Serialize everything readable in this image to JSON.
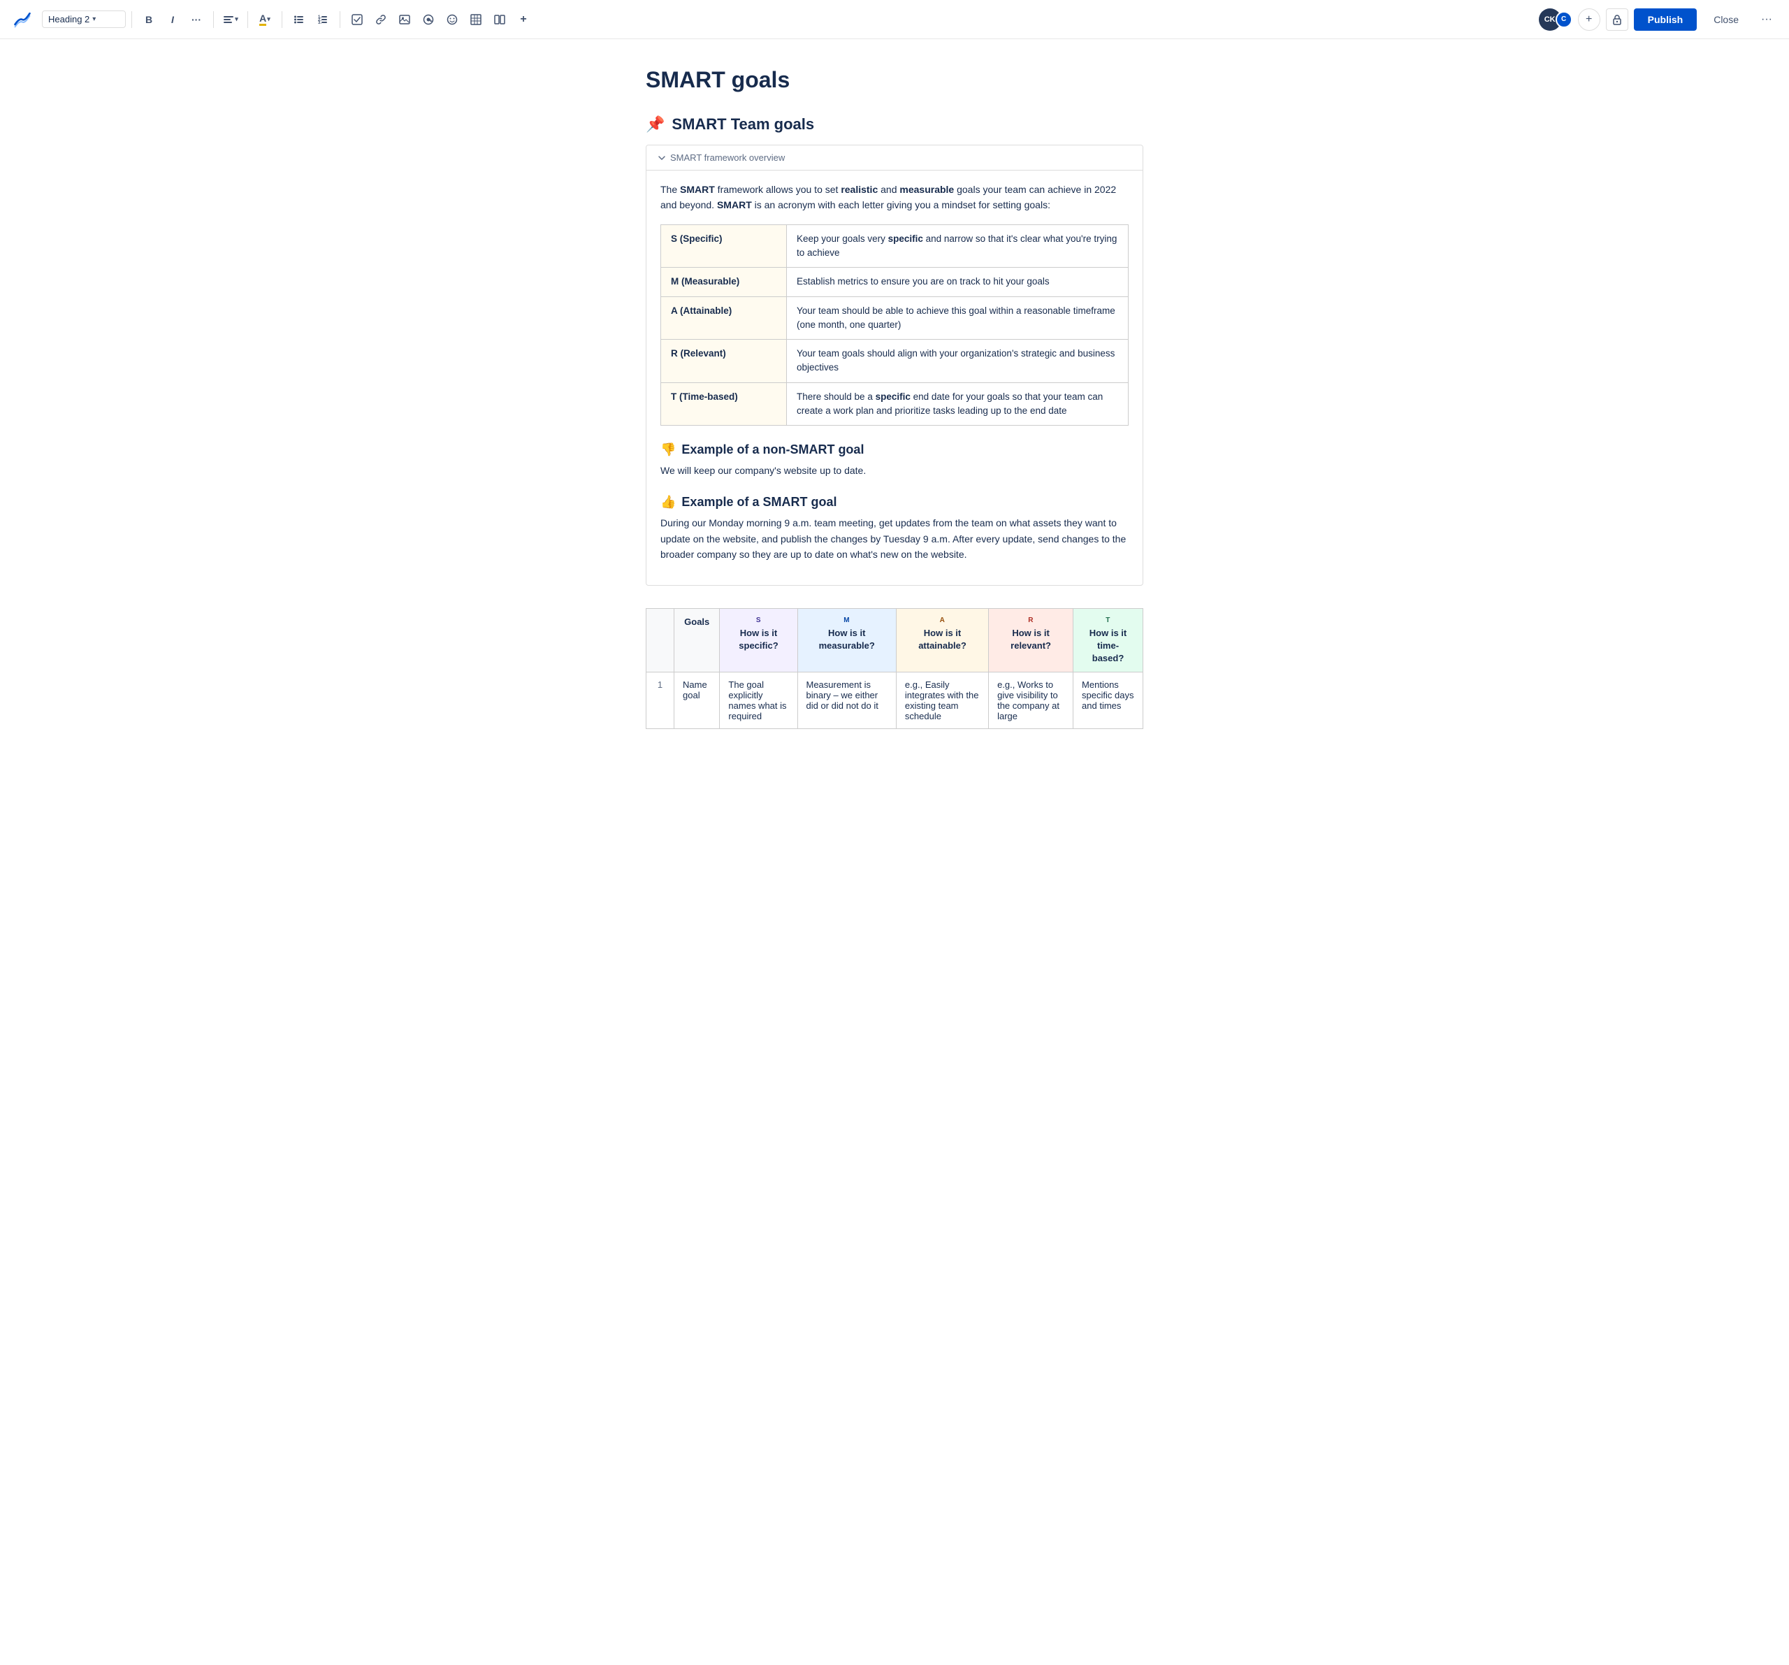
{
  "toolbar": {
    "logo_alt": "Confluence logo",
    "heading_selector": "Heading 2",
    "chevron": "▾",
    "bold": "B",
    "italic": "I",
    "more_format": "···",
    "align_icon": "≡",
    "color_icon": "A",
    "bullet_list": "☰",
    "number_list": "≡",
    "task": "☑",
    "link": "🔗",
    "media": "🖼",
    "mention": "@",
    "emoji": "☺",
    "table": "⊞",
    "column": "⊟",
    "insert": "+",
    "avatar_ck": "CK",
    "avatar_c": "C",
    "add_btn": "+",
    "lock_icon": "🔒",
    "publish_label": "Publish",
    "close_label": "Close",
    "more_options": "···"
  },
  "page": {
    "title": "SMART goals",
    "section_heading_emoji": "📌",
    "section_heading_text": "SMART Team goals",
    "expand_label": "SMART framework overview",
    "intro_text_1_pre": "The ",
    "intro_bold_1": "SMART",
    "intro_text_1_mid": " framework allows you to set ",
    "intro_bold_2": "realistic",
    "intro_text_1_and": " and ",
    "intro_bold_3": "measurable",
    "intro_text_1_post": " goals your team can achieve in 2022 and beyond. ",
    "intro_bold_4": "SMART",
    "intro_text_1_end": " is an acronym with each letter giving you a mindset for setting goals:",
    "smart_rows": [
      {
        "letter": "S (Specific)",
        "description": "Keep your goals very specific and narrow so that it's clear what you're trying to achieve"
      },
      {
        "letter": "M (Measurable)",
        "description": "Establish metrics to ensure you are on track to hit your goals"
      },
      {
        "letter": "A (Attainable)",
        "description": "Your team should be able to achieve this goal within a reasonable timeframe (one month, one quarter)"
      },
      {
        "letter": "R (Relevant)",
        "description": "Your team goals should align with your organization's strategic and business objectives"
      },
      {
        "letter": "T (Time-based)",
        "description": "There should be a specific end date for your goals so that your team can create a work plan and prioritize tasks leading up to the end date"
      }
    ],
    "non_smart_heading_emoji": "👎",
    "non_smart_heading_text": "Example of a non-SMART goal",
    "non_smart_body": "We will keep our company's website up to date.",
    "smart_heading_emoji": "👍",
    "smart_heading_text": "Example of a SMART goal",
    "smart_body": "During our Monday morning 9 a.m. team meeting, get updates from the team on what assets they want to update on the website, and publish the changes by Tuesday 9 a.m. After every update, send changes to the broader company so they are up to date on what's new on the website.",
    "goals_table": {
      "col_goals": "Goals",
      "col_specific_label": "S",
      "col_specific_question": "How is it specific?",
      "col_measurable_label": "M",
      "col_measurable_question": "How is it measurable?",
      "col_attainable_label": "A",
      "col_attainable_question": "How is it attainable?",
      "col_relevant_label": "R",
      "col_relevant_question": "How is it relevant?",
      "col_timebased_label": "T",
      "col_timebased_question": "How is it time-based?",
      "rows": [
        {
          "num": "1",
          "goal": "Name goal",
          "specific": "The goal explicitly names what is required",
          "measurable": "Measurement is binary – we either did or did not do it",
          "attainable": "e.g., Easily integrates with the existing team schedule",
          "relevant": "e.g., Works to give visibility to the company at large",
          "timebased": "Mentions specific days and times"
        }
      ]
    }
  }
}
